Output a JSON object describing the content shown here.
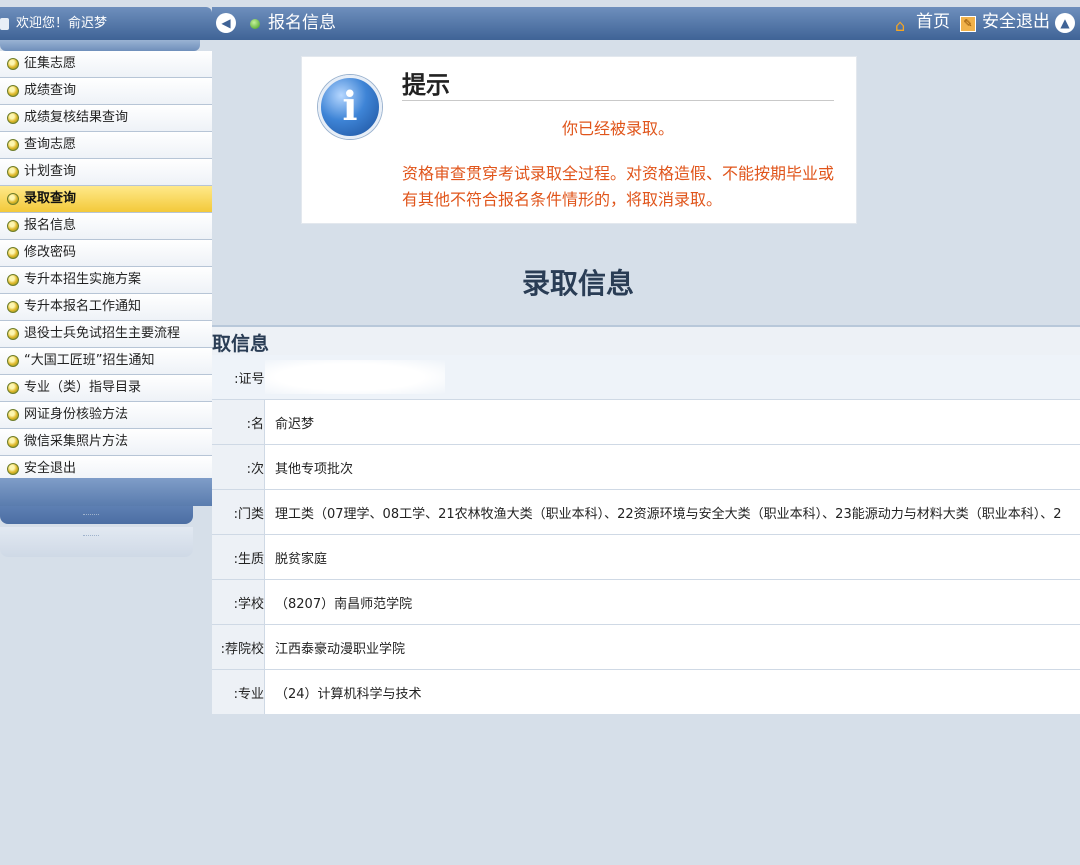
{
  "sidebar": {
    "welcome": "欢迎您！俞迟梦",
    "items": [
      {
        "label": "征集志愿"
      },
      {
        "label": "成绩查询"
      },
      {
        "label": "成绩复核结果查询"
      },
      {
        "label": "查询志愿"
      },
      {
        "label": "计划查询"
      },
      {
        "label": "录取查询",
        "active": true
      },
      {
        "label": "报名信息"
      },
      {
        "label": "修改密码"
      },
      {
        "label": "专升本招生实施方案"
      },
      {
        "label": "专升本报名工作通知"
      },
      {
        "label": "退役士兵免试招生主要流程"
      },
      {
        "label": "“大国工匠班”招生通知"
      },
      {
        "label": "专业（类）指导目录"
      },
      {
        "label": "网证身份核验方法"
      },
      {
        "label": "微信采集照片方法"
      },
      {
        "label": "安全退出"
      }
    ]
  },
  "topbar": {
    "page_title": "报名信息",
    "home": "首页",
    "logout": "安全退出"
  },
  "notice": {
    "title": "提示",
    "message": "你已经被录取。",
    "warning": "资格审查贯穿考试录取全过程。对资格造假、不能按期毕业或有其他不符合报名条件情形的，将取消录取。"
  },
  "main": {
    "heading": "录取信息",
    "section_title": "取信息",
    "rows": [
      {
        "label": "证号:",
        "value": ""
      },
      {
        "label": "名:",
        "value": "俞迟梦"
      },
      {
        "label": "次:",
        "value": "其他专项批次"
      },
      {
        "label": "门类:",
        "value": "理工类（07理学、08工学、21农林牧渔大类（职业本科）、22资源环境与安全大类（职业本科）、23能源动力与材料大类（职业本科）、2"
      },
      {
        "label": "生质:",
        "value": "脱贫家庭"
      },
      {
        "label": "学校:",
        "value": "（8207）南昌师范学院"
      },
      {
        "label": "荐院校:",
        "value": "江西泰豪动漫职业学院"
      },
      {
        "label": "专业:",
        "value": "（24）计算机科学与技术"
      }
    ]
  }
}
